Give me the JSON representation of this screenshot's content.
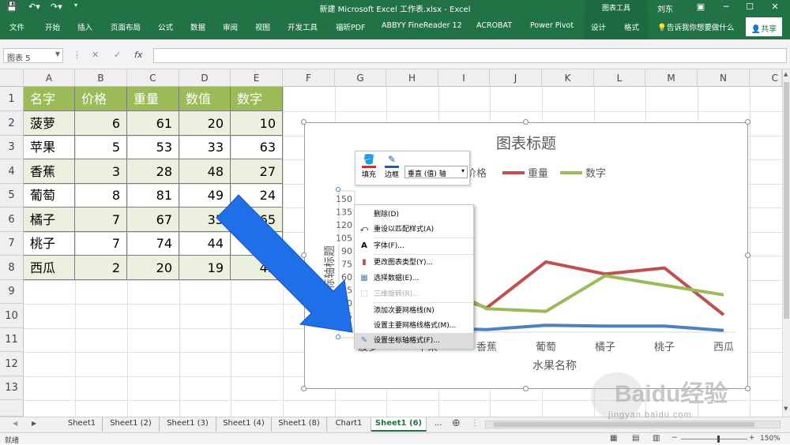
{
  "window": {
    "title": "新建 Microsoft Excel 工作表.xlsx  -  Excel",
    "context_tab": "图表工具",
    "user": "刘东"
  },
  "ribbon": {
    "tabs": [
      "文件",
      "开始",
      "插入",
      "页面布局",
      "公式",
      "数据",
      "审阅",
      "视图",
      "开发工具",
      "福昕PDF",
      "ABBYY FineReader 12",
      "ACROBAT",
      "Power Pivot",
      "设计",
      "格式"
    ],
    "tell_me": "告诉我你想要做什么",
    "share": "共享"
  },
  "formula_bar": {
    "name_box": "图表 5",
    "fx": "fx",
    "value": ""
  },
  "columns": [
    "A",
    "B",
    "C",
    "D",
    "E",
    "F",
    "G",
    "H",
    "I",
    "J",
    "K",
    "L",
    "M",
    "N",
    "C"
  ],
  "rows": [
    "1",
    "2",
    "3",
    "4",
    "5",
    "6",
    "7",
    "8",
    "9",
    "10",
    "11",
    "12",
    "13"
  ],
  "table": {
    "headers": [
      "名字",
      "价格",
      "重量",
      "数值",
      "数字"
    ],
    "rows": [
      [
        "菠萝",
        "6",
        "61",
        "20",
        "10"
      ],
      [
        "苹果",
        "5",
        "53",
        "33",
        "63"
      ],
      [
        "香蕉",
        "3",
        "28",
        "48",
        "27"
      ],
      [
        "葡萄",
        "8",
        "81",
        "49",
        "24"
      ],
      [
        "橘子",
        "7",
        "67",
        "35",
        "65"
      ],
      [
        "桃子",
        "7",
        "74",
        "44",
        "54"
      ],
      [
        "西瓜",
        "2",
        "20",
        "19",
        "43"
      ]
    ]
  },
  "chart_data": {
    "type": "line",
    "title": "图表标题",
    "xlabel": "水果名称",
    "ylabel": "坐标轴标题",
    "categories": [
      "菠萝",
      "苹果",
      "香蕉",
      "葡萄",
      "橘子",
      "桃子",
      "西瓜"
    ],
    "series": [
      {
        "name": "价格",
        "color": "#4f81bd",
        "values": [
          6,
          5,
          3,
          8,
          7,
          7,
          2
        ]
      },
      {
        "name": "重量",
        "color": "#c0504d",
        "values": [
          61,
          53,
          28,
          81,
          67,
          74,
          20
        ]
      },
      {
        "name": "数字",
        "color": "#9bbb59",
        "values": [
          10,
          63,
          27,
          24,
          65,
          54,
          43
        ]
      }
    ],
    "y_ticks": [
      "150",
      "135",
      "120",
      "105",
      "90",
      "75",
      "60",
      "45",
      "30",
      "15",
      "0"
    ],
    "ylim": [
      0,
      150
    ],
    "legend_position": "top",
    "visible_category_labels": [
      "香蕉",
      "葡萄",
      "橘子",
      "桃子",
      "西瓜"
    ],
    "visible_legend": [
      "价格",
      "重量",
      "数字"
    ]
  },
  "mini_toolbar": {
    "fill_label": "填充",
    "outline_label": "边框",
    "element_select": "垂直 (值) 轴"
  },
  "context_menu": {
    "items": [
      {
        "label": "删除(D)",
        "icon": "",
        "disabled": false,
        "hover": false
      },
      {
        "label": "重设以匹配样式(A)",
        "icon": "reset-icon",
        "disabled": false,
        "hover": false
      },
      {
        "label": "字体(F)...",
        "icon": "font-icon",
        "disabled": false,
        "hover": false
      },
      {
        "label": "更改图表类型(Y)...",
        "icon": "chart-type-icon",
        "disabled": false,
        "hover": false
      },
      {
        "label": "选择数据(E)...",
        "icon": "select-data-icon",
        "disabled": false,
        "hover": false
      },
      {
        "label": "三维旋转(R)...",
        "icon": "3d-rotate-icon",
        "disabled": true,
        "hover": false
      },
      {
        "label": "添加次要网格线(N)",
        "icon": "",
        "disabled": false,
        "hover": false
      },
      {
        "label": "设置主要网格线格式(M)...",
        "icon": "",
        "disabled": false,
        "hover": false
      },
      {
        "label": "设置坐标轴格式(F)...",
        "icon": "format-axis-icon",
        "disabled": false,
        "hover": true
      }
    ]
  },
  "sheets": {
    "tabs": [
      "Sheet1",
      "Sheet1 (2)",
      "Sheet1 (3)",
      "Sheet1 (4)",
      "Sheet1 (8)",
      "Chart1",
      "Sheet1 (6)"
    ],
    "active_index": 6,
    "more": "...",
    "add": "⊕"
  },
  "status": {
    "mode": "就绪",
    "zoom": "150%"
  },
  "watermark": {
    "brand": "Baidu经验",
    "url": "jingyan.baidu.com"
  },
  "colors": {
    "excel_green": "#217346",
    "table_header": "#9bbb59",
    "table_band": "#ebf1de",
    "arrow_blue": "#1f6fe8"
  }
}
